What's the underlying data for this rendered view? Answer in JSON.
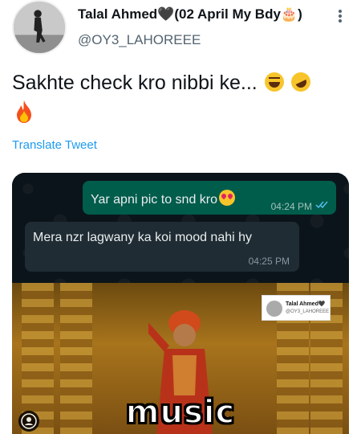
{
  "tweet": {
    "author_name": "Talal Ahmed🖤(02 April My Bdy🎂)",
    "handle": "@OY3_LAHOREEE",
    "text": "Sakhte check kro nibbi ke...",
    "translate_label": "Translate Tweet"
  },
  "media": {
    "chat": {
      "outgoing_message": "Yar apni pic to snd kro",
      "outgoing_time": "04:24 PM",
      "incoming_message": "Mera nzr lagwany ka koi mood nahi hy",
      "incoming_time": "04:25 PM"
    },
    "meme": {
      "caption": "music",
      "watermark_name": "Talal Ahmed🖤",
      "watermark_handle": "@OY3_LAHOREEE"
    }
  },
  "icons": {
    "more": "more-vertical-icon",
    "fire": "fire-emoji",
    "profile": "profile-icon"
  },
  "colors": {
    "link": "#1d9bf0",
    "handle": "#536471",
    "whatsapp_out": "#005c4b",
    "whatsapp_in": "#1f2c33"
  }
}
